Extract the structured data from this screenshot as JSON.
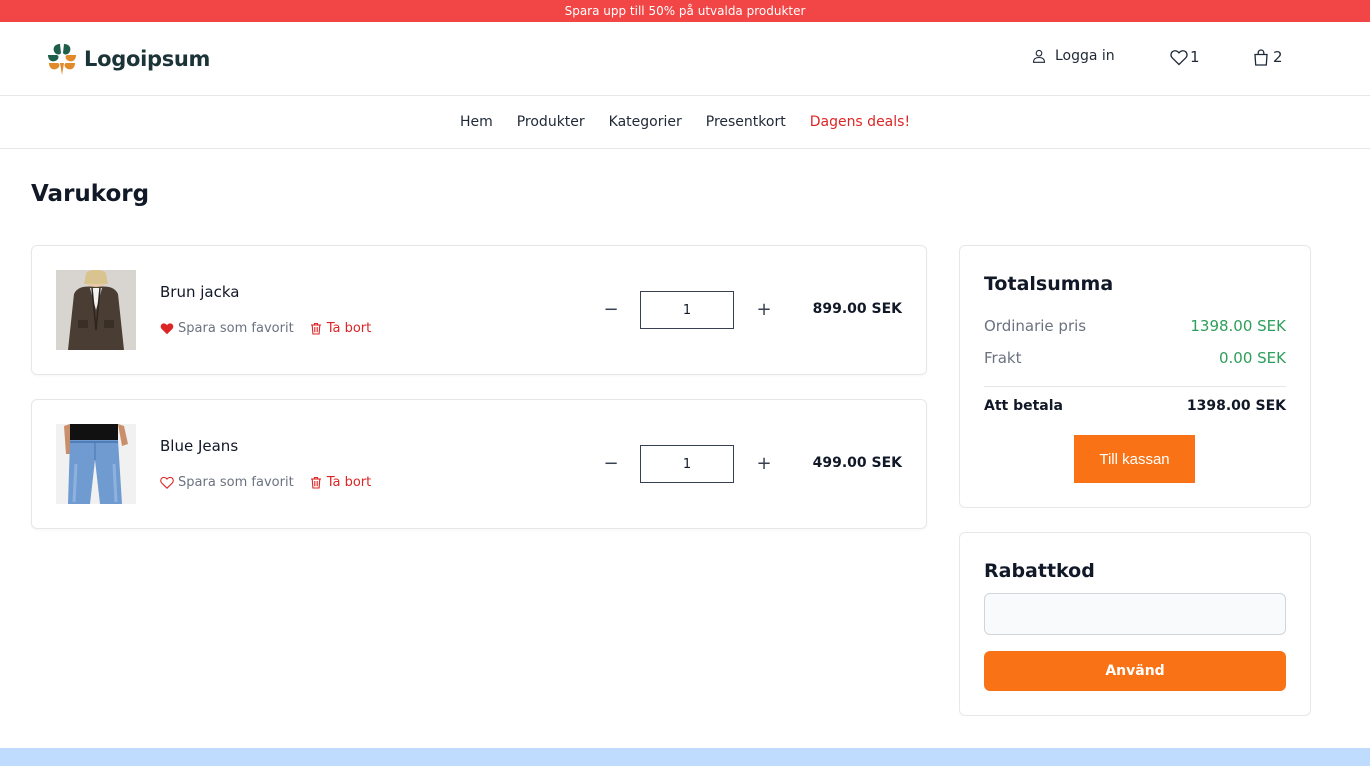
{
  "promo": {
    "text": "Spara upp till 50% på utvalda produkter"
  },
  "header": {
    "logo_text": "Logoipsum",
    "login_label": "Logga in",
    "favorites_count": "1",
    "cart_count": "2"
  },
  "nav": {
    "items": [
      "Hem",
      "Produkter",
      "Kategorier",
      "Presentkort",
      "Dagens deals!"
    ]
  },
  "page": {
    "title": "Varukorg"
  },
  "cart": {
    "items": [
      {
        "name": "Brun jacka",
        "favorite_label": "Spara som favorit",
        "favorited": true,
        "remove_label": "Ta bort",
        "quantity": "1",
        "price": "899.00 SEK"
      },
      {
        "name": "Blue Jeans",
        "favorite_label": "Spara som favorit",
        "favorited": false,
        "remove_label": "Ta bort",
        "quantity": "1",
        "price": "499.00 SEK"
      }
    ],
    "minus_symbol": "−",
    "plus_symbol": "+"
  },
  "summary": {
    "title": "Totalsumma",
    "regular_label": "Ordinarie pris",
    "regular_value": "1398.00 SEK",
    "shipping_label": "Frakt",
    "shipping_value": "0.00 SEK",
    "total_label": "Att betala",
    "total_value": "1398.00 SEK",
    "checkout_label": "Till kassan"
  },
  "discount": {
    "title": "Rabattkod",
    "input_value": "",
    "apply_label": "Använd"
  },
  "colors": {
    "promo_bg": "#f24545",
    "accent_orange": "#f97316",
    "price_green": "#2e9e5b",
    "danger_red": "#dc2626",
    "footer_band": "#bfdbfe"
  }
}
